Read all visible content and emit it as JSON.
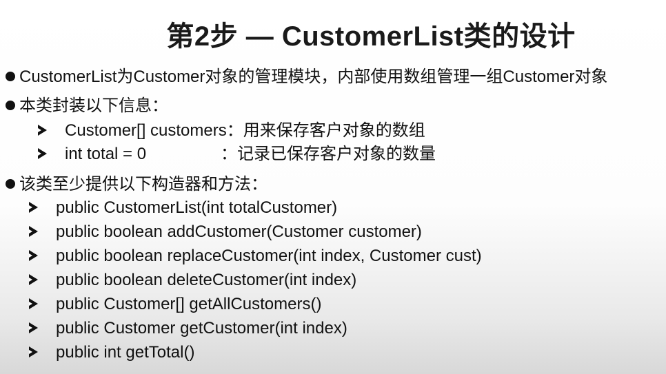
{
  "slide": {
    "title": "第2步 — CustomerList类的设计",
    "bullets": [
      "CustomerList为Customer对象的管理模块，内部使用数组管理一组Customer对象",
      "本类封装以下信息：",
      "该类至少提供以下构造器和方法："
    ],
    "fields": [
      {
        "code": "Customer[] customers",
        "desc": "：用来保存客户对象的数组"
      },
      {
        "code": "int total = 0",
        "desc": "：记录已保存客户对象的数量"
      }
    ],
    "methods": [
      "public CustomerList(int totalCustomer)",
      "public boolean addCustomer(Customer customer)",
      "public boolean replaceCustomer(int index, Customer cust)",
      "public boolean deleteCustomer(int index)",
      "public Customer[] getAllCustomers()",
      "public Customer getCustomer(int index)",
      "public int getTotal()"
    ]
  }
}
